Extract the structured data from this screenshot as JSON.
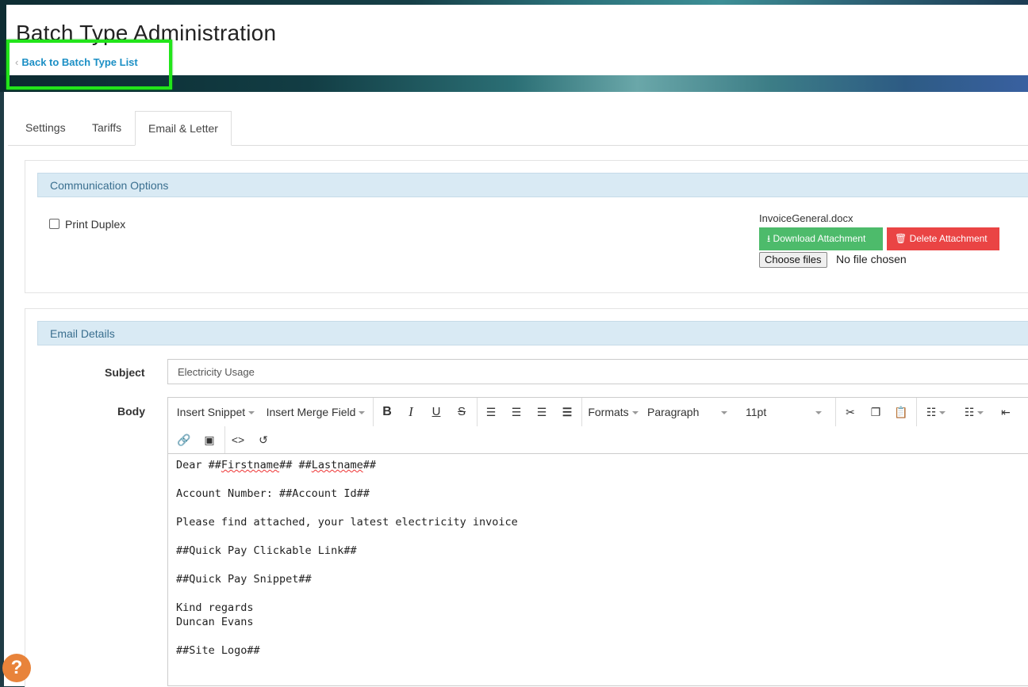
{
  "header": {
    "title": "Batch Type Administration",
    "back_link": "Back to Batch Type List",
    "back_chevron": "‹"
  },
  "tabs": [
    {
      "label": "Settings",
      "active": false
    },
    {
      "label": "Tariffs",
      "active": false
    },
    {
      "label": "Email & Letter",
      "active": true
    }
  ],
  "communication": {
    "heading": "Communication Options",
    "print_duplex_label": "Print Duplex",
    "print_duplex_checked": false,
    "attachment_filename": "InvoiceGeneral.docx",
    "download_label": "Download Attachment",
    "delete_label": "Delete Attachment",
    "choose_files_label": "Choose files",
    "no_file_label": "No file chosen"
  },
  "email": {
    "heading": "Email Details",
    "subject_label": "Subject",
    "subject_value": "Electricity Usage",
    "body_label": "Body",
    "toolbar": {
      "insert_snippet": "Insert Snippet",
      "insert_merge_field": "Insert Merge Field",
      "formats": "Formats",
      "paragraph": "Paragraph",
      "font_size": "11pt"
    },
    "body_lines": {
      "l1_pre": "Dear ##",
      "l1_first": "Firstname",
      "l1_mid": "## ##",
      "l1_last": "Lastname",
      "l1_post": "##",
      "l2": "Account Number: ##Account Id##",
      "l3": "Please find attached, your latest electricity invoice",
      "l4": "##Quick Pay Clickable Link##",
      "l5": "##Quick Pay Snippet##",
      "l6": "Kind regards",
      "l7": "Duncan Evans",
      "l8": "##Site Logo##"
    }
  },
  "colors": {
    "accent_link": "#1b8fc5",
    "highlight_box": "#22e51a",
    "download_button": "#4dbb6b",
    "delete_button": "#ea4444",
    "panel_header": "#d9eaf4",
    "help_icon": "#e8833a"
  },
  "icons": {
    "help": "?"
  }
}
